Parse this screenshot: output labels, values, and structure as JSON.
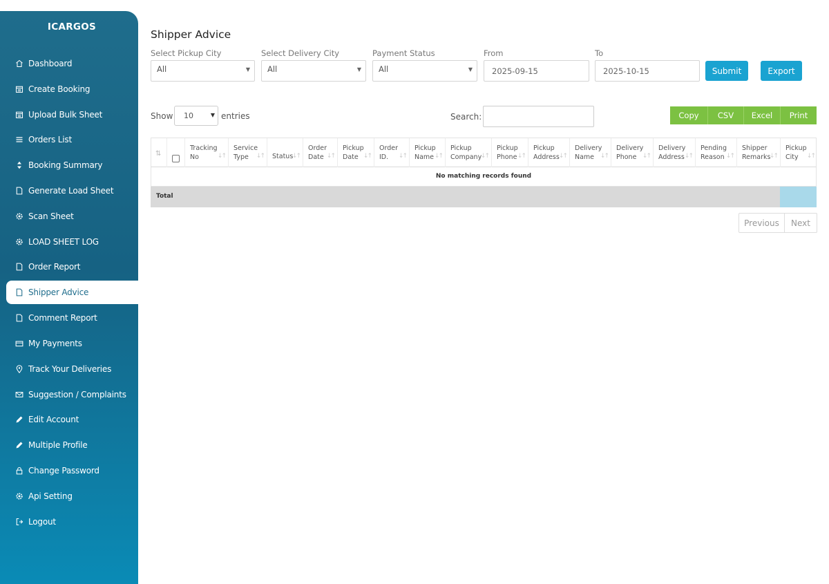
{
  "sidebar": {
    "brand": "ICARGOS",
    "items": [
      {
        "label": "Dashboard",
        "icon": "home-icon"
      },
      {
        "label": "Create Booking",
        "icon": "calendar-icon"
      },
      {
        "label": "Upload Bulk Sheet",
        "icon": "calendar-icon"
      },
      {
        "label": "Orders List",
        "icon": "list-icon"
      },
      {
        "label": "Booking Summary",
        "icon": "sort-icon"
      },
      {
        "label": "Generate Load Sheet",
        "icon": "file-icon"
      },
      {
        "label": "Scan Sheet",
        "icon": "gear-icon"
      },
      {
        "label": "LOAD SHEET LOG",
        "icon": "gear-icon"
      },
      {
        "label": "Order Report",
        "icon": "file-icon"
      },
      {
        "label": "Shipper Advice",
        "icon": "file-icon",
        "active": true
      },
      {
        "label": "Comment Report",
        "icon": "file-icon"
      },
      {
        "label": "My Payments",
        "icon": "wallet-icon"
      },
      {
        "label": "Track Your Deliveries",
        "icon": "map-pin-icon"
      },
      {
        "label": "Suggestion / Complaints",
        "icon": "envelope-icon"
      },
      {
        "label": "Edit Account",
        "icon": "pencil-icon"
      },
      {
        "label": "Multiple Profile",
        "icon": "pencil-icon"
      },
      {
        "label": "Change Password",
        "icon": "lock-icon"
      },
      {
        "label": "Api Setting",
        "icon": "gear-icon"
      },
      {
        "label": "Logout",
        "icon": "logout-icon"
      }
    ]
  },
  "page": {
    "title": "Shipper Advice"
  },
  "filters": {
    "pickup_city": {
      "label": "Select Pickup City",
      "value": "All"
    },
    "delivery_city": {
      "label": "Select Delivery City",
      "value": "All"
    },
    "payment_status": {
      "label": "Payment Status",
      "value": "All"
    },
    "from": {
      "label": "From",
      "value": "2025-09-15"
    },
    "to": {
      "label": "To",
      "value": "2025-10-15"
    },
    "submit_label": "Submit",
    "export_label": "Export"
  },
  "table_controls": {
    "show_label": "Show",
    "entries_value": "10",
    "entries_label": "entries",
    "search_label": "Search:",
    "export_buttons": [
      "Copy",
      "CSV",
      "Excel",
      "Print"
    ]
  },
  "table": {
    "columns": [
      [
        "Tracking",
        "No"
      ],
      [
        "Service",
        "Type"
      ],
      [
        "Status",
        ""
      ],
      [
        "Order",
        "Date"
      ],
      [
        "Pickup",
        "Date"
      ],
      [
        "Order",
        "ID."
      ],
      [
        "Pickup",
        "Name"
      ],
      [
        "Pickup",
        "Company"
      ],
      [
        "Pickup",
        "Phone"
      ],
      [
        "Pickup",
        "Address"
      ],
      [
        "Delivery",
        "Name"
      ],
      [
        "Delivery",
        "Phone"
      ],
      [
        "Delivery",
        "Address"
      ],
      [
        "Pending",
        "Reason"
      ],
      [
        "Shipper",
        "Remarks"
      ],
      [
        "Pickup",
        "City"
      ]
    ],
    "empty_message": "No matching records found",
    "total_label": "Total"
  },
  "pagination": {
    "previous": "Previous",
    "next": "Next"
  },
  "colors": {
    "sidebar": "#1f6d8c",
    "primary_button": "#1aa3d1",
    "export_button": "#7cc142",
    "total_row": "#d9d9d9",
    "total_highlight": "#a9d9ea"
  }
}
